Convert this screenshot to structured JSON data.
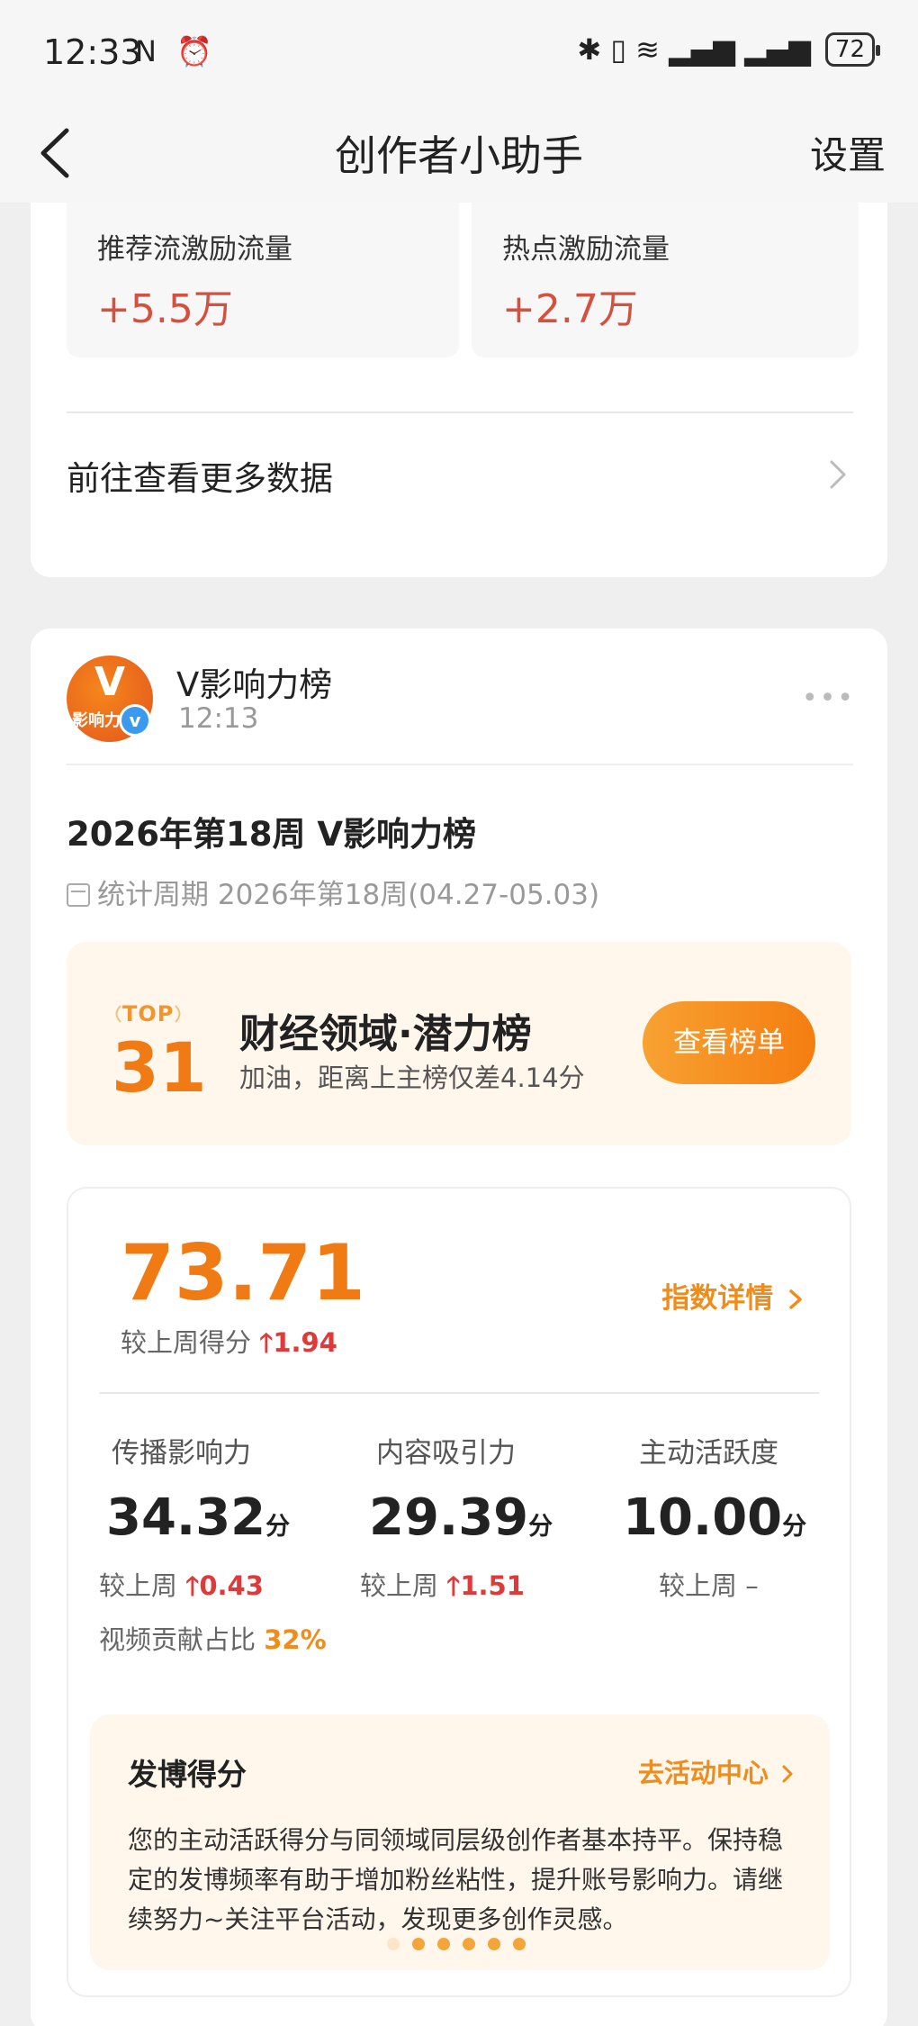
{
  "status": {
    "time": "12:33",
    "left_icons": "N ⏰",
    "right_icons": "✱ ▯ ≋ ▂▄▆ ▂▄▆",
    "battery": "72"
  },
  "header": {
    "title": "创作者小助手",
    "settings": "设置"
  },
  "stats": [
    {
      "label": "推荐流激励流量",
      "value": "+5.5万"
    },
    {
      "label": "热点激励流量",
      "value": "+2.7万"
    }
  ],
  "more_data": "前往查看更多数据",
  "account": {
    "name": "V影响力榜",
    "time": "12:13",
    "avatar_letter": "V",
    "avatar_text": "影响力榜",
    "verified": "v"
  },
  "post": {
    "title": "2026年第18周 V影响力榜",
    "period": "统计周期 2026年第18周(04.27-05.03)"
  },
  "rank": {
    "top_label": "TOP",
    "number": "31",
    "name": "财经领域·潜力榜",
    "desc": "加油，距离上主榜仅差4.14分",
    "button": "查看榜单"
  },
  "score": {
    "value": "73.71",
    "compare_label": "较上周得分",
    "delta": "1.94",
    "detail_link": "指数详情"
  },
  "metrics": [
    {
      "label": "传播影响力",
      "value": "34.32",
      "unit": "分",
      "cmp_label": "较上周",
      "delta": "0.43",
      "note_label": "视频贡献占比",
      "note_value": "32%"
    },
    {
      "label": "内容吸引力",
      "value": "29.39",
      "unit": "分",
      "cmp_label": "较上周",
      "delta": "1.51"
    },
    {
      "label": "主动活跃度",
      "value": "10.00",
      "unit": "分",
      "cmp_label": "较上周 –"
    }
  ],
  "post_score": {
    "title": "发博得分",
    "link": "去活动中心",
    "body": "您的主动活跃得分与同领域同层级创作者基本持平。保持稳定的发博频率有助于增加粉丝粘性，提升账号影响力。请继续努力~关注平台活动，发现更多创作灵感。"
  },
  "colors": {
    "accent": "#f07a14",
    "up": "#e0393a",
    "stat_value": "#d3513f"
  }
}
